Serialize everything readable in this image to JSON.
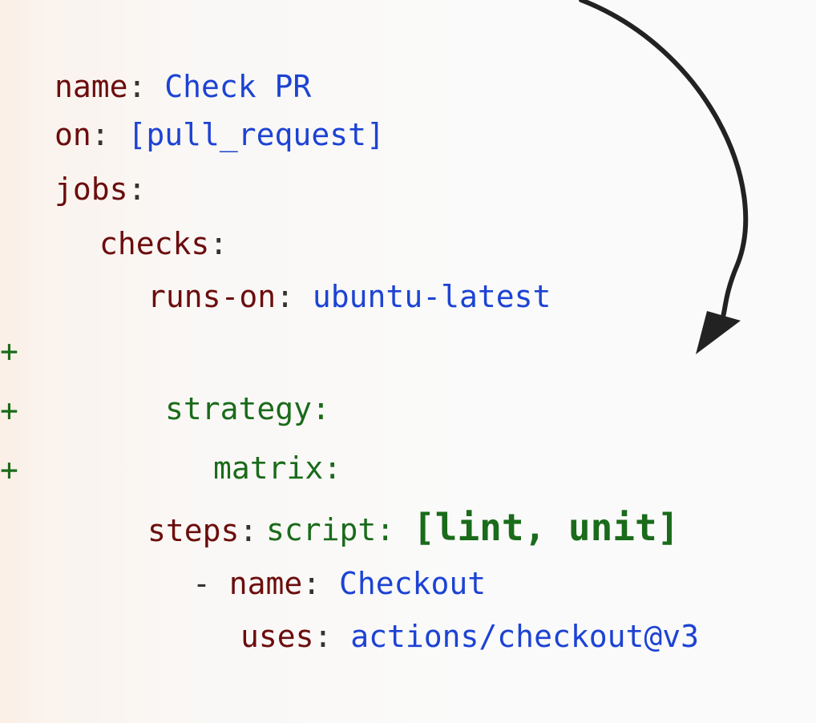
{
  "diff_marker": "+",
  "code": {
    "l1": {
      "key": "name",
      "sep": ":",
      "value": " Check PR"
    },
    "l2": {
      "key": "on",
      "sep": ":",
      "value": " [pull_request]"
    },
    "l3": {
      "key": "jobs",
      "sep": ":"
    },
    "l4": {
      "key": "checks",
      "sep": ":"
    },
    "l5": {
      "key": "runs-on",
      "sep": ":",
      "value": " ubuntu-latest"
    },
    "l6": {
      "key": "strategy",
      "sep": ":"
    },
    "l7": {
      "key": "matrix",
      "sep": ":"
    },
    "l8": {
      "key": "script",
      "sep": ":",
      "value": "[lint, unit]"
    },
    "l9": {
      "key": "steps",
      "sep": ":"
    },
    "l10": {
      "dash": "- ",
      "key": "name",
      "sep": ":",
      "value": " Checkout"
    },
    "l11": {
      "key": "uses",
      "sep": ":",
      "value": " actions/checkout@v3"
    }
  },
  "colors": {
    "key": "#6b0d0d",
    "value": "#1d43d4",
    "added": "#1a6b1a",
    "arrow": "#222222"
  }
}
